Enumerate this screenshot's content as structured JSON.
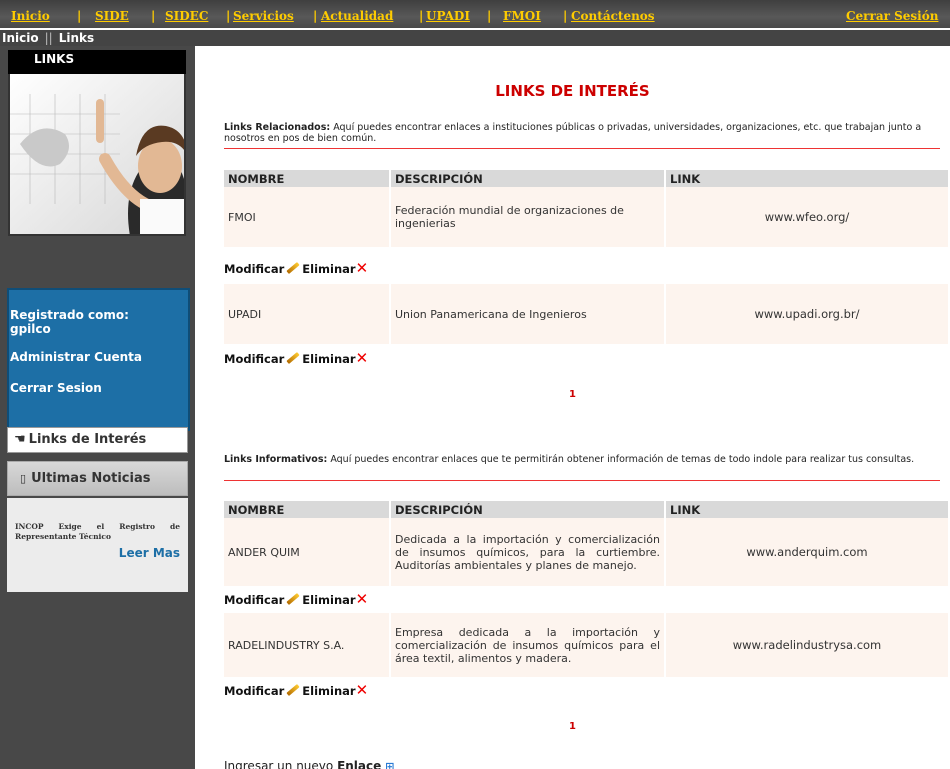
{
  "nav": {
    "items": [
      "Inicio",
      "SIDE",
      "SIDEC",
      "Servicios",
      "Actualidad",
      "UPADI",
      "FMOI",
      "Contáctenos"
    ],
    "logout": "Cerrar Sesión"
  },
  "breadcrumb": {
    "home": "Inicio",
    "separator": "||",
    "current": "Links"
  },
  "sidebar": {
    "title": "LINKS",
    "account": {
      "registered_label": "Registrado como:",
      "username": "gpilco",
      "manage": "Administrar Cuenta",
      "logout": "Cerrar Sesion"
    },
    "links_item": "Links de Interés",
    "news_title": "Ultimas Noticias",
    "news_text": "INCOP Exige el Registro de Representante Técnico",
    "news_more": "Leer Mas"
  },
  "main": {
    "title": "LINKS DE INTERÉS",
    "related": {
      "heading": "Links Relacionados:",
      "text": "Aquí puedes encontrar enlaces a instituciones públicas o privadas, universidades, organizaciones, etc. que trabajan junto a nosotros en pos de bien común.",
      "columns": [
        "NOMBRE",
        "DESCRIPCIÓN",
        "LINK"
      ],
      "rows": [
        {
          "name": "FMOI",
          "description": "Federación mundial de organizaciones de ingenierias",
          "link": "www.wfeo.org/"
        },
        {
          "name": "UPADI",
          "description": "Union Panamericana de Ingenieros",
          "link": "www.upadi.org.br/"
        }
      ],
      "page": "1"
    },
    "informative": {
      "heading": "Links Informativos:",
      "text": "Aquí puedes encontrar enlaces que te permitirán obtener información de temas de todo indole para realizar tus consultas.",
      "columns": [
        "NOMBRE",
        "DESCRIPCIÓN",
        "LINK"
      ],
      "rows": [
        {
          "name": "ANDER QUIM",
          "description": "Dedicada a la importación y comercialización de insumos químicos, para la curtiembre. Auditorías ambientales y planes de manejo.",
          "link": "www.anderquim.com"
        },
        {
          "name": "RADELINDUSTRY S.A.",
          "description": "Empresa dedicada a la importación y comercialización de insumos químicos para el área textil, alimentos y madera.",
          "link": "www.radelindustrysa.com"
        }
      ],
      "page": "1"
    },
    "actions": {
      "modify": "Modificar",
      "delete": "Eliminar"
    },
    "new_link": {
      "prefix": "Ingresar un nuevo",
      "bold": "Enlace"
    }
  }
}
